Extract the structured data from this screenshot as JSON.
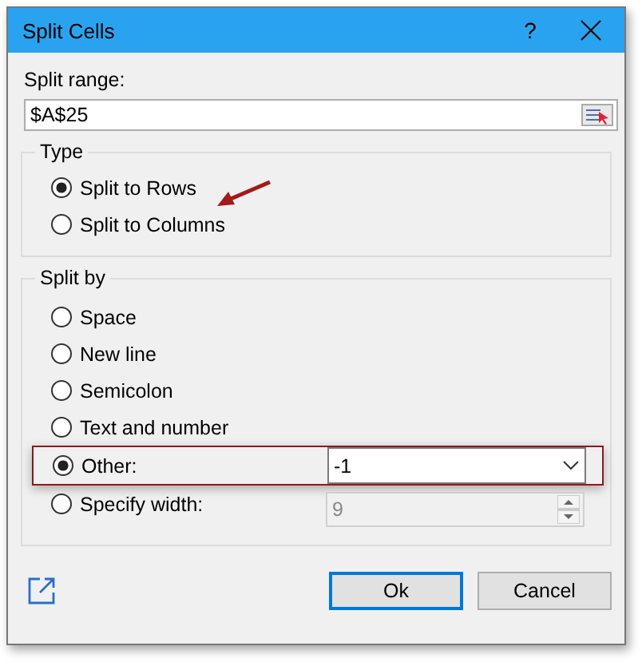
{
  "window": {
    "title": "Split Cells",
    "help": "?"
  },
  "split_range": {
    "label": "Split range:",
    "value": "$A$25"
  },
  "type_group": {
    "title": "Type",
    "options": [
      {
        "label": "Split to Rows",
        "selected": true
      },
      {
        "label": "Split to Columns",
        "selected": false
      }
    ]
  },
  "split_by_group": {
    "title": "Split by",
    "options": [
      {
        "label": "Space",
        "selected": false,
        "kind": "plain"
      },
      {
        "label": "New line",
        "selected": false,
        "kind": "plain"
      },
      {
        "label": "Semicolon",
        "selected": false,
        "kind": "plain"
      },
      {
        "label": "Text and number",
        "selected": false,
        "kind": "plain"
      },
      {
        "label": "Other:",
        "selected": true,
        "kind": "combo",
        "value": "-1"
      },
      {
        "label": "Specify width:",
        "selected": false,
        "kind": "spin",
        "value": "9",
        "disabled": true
      }
    ]
  },
  "buttons": [
    {
      "label": "Ok",
      "selected": true
    },
    {
      "label": "Cancel",
      "selected": false
    }
  ]
}
